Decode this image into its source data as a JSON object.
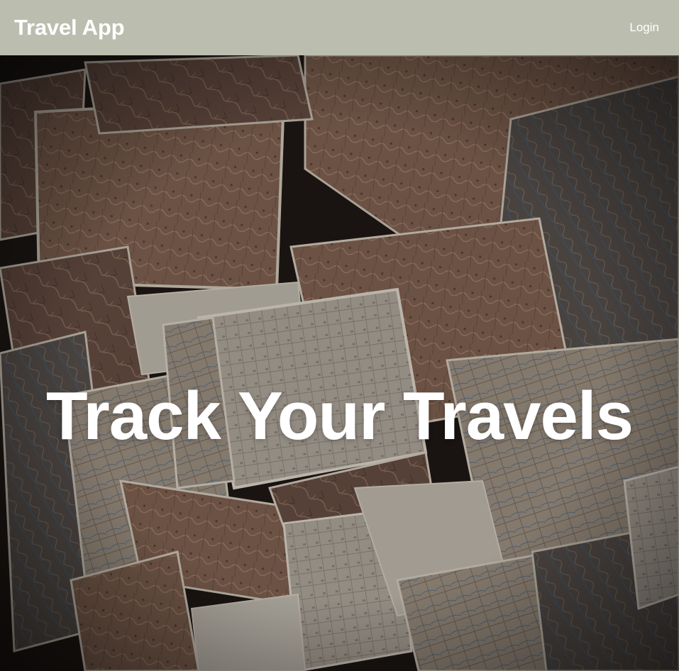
{
  "header": {
    "brand": "Travel App",
    "login_label": "Login"
  },
  "hero": {
    "title": "Track Your Travels",
    "background": "scattered-old-maps-photo"
  },
  "colors": {
    "navbar_bg": "#bbbeaf",
    "text": "#ffffff"
  }
}
